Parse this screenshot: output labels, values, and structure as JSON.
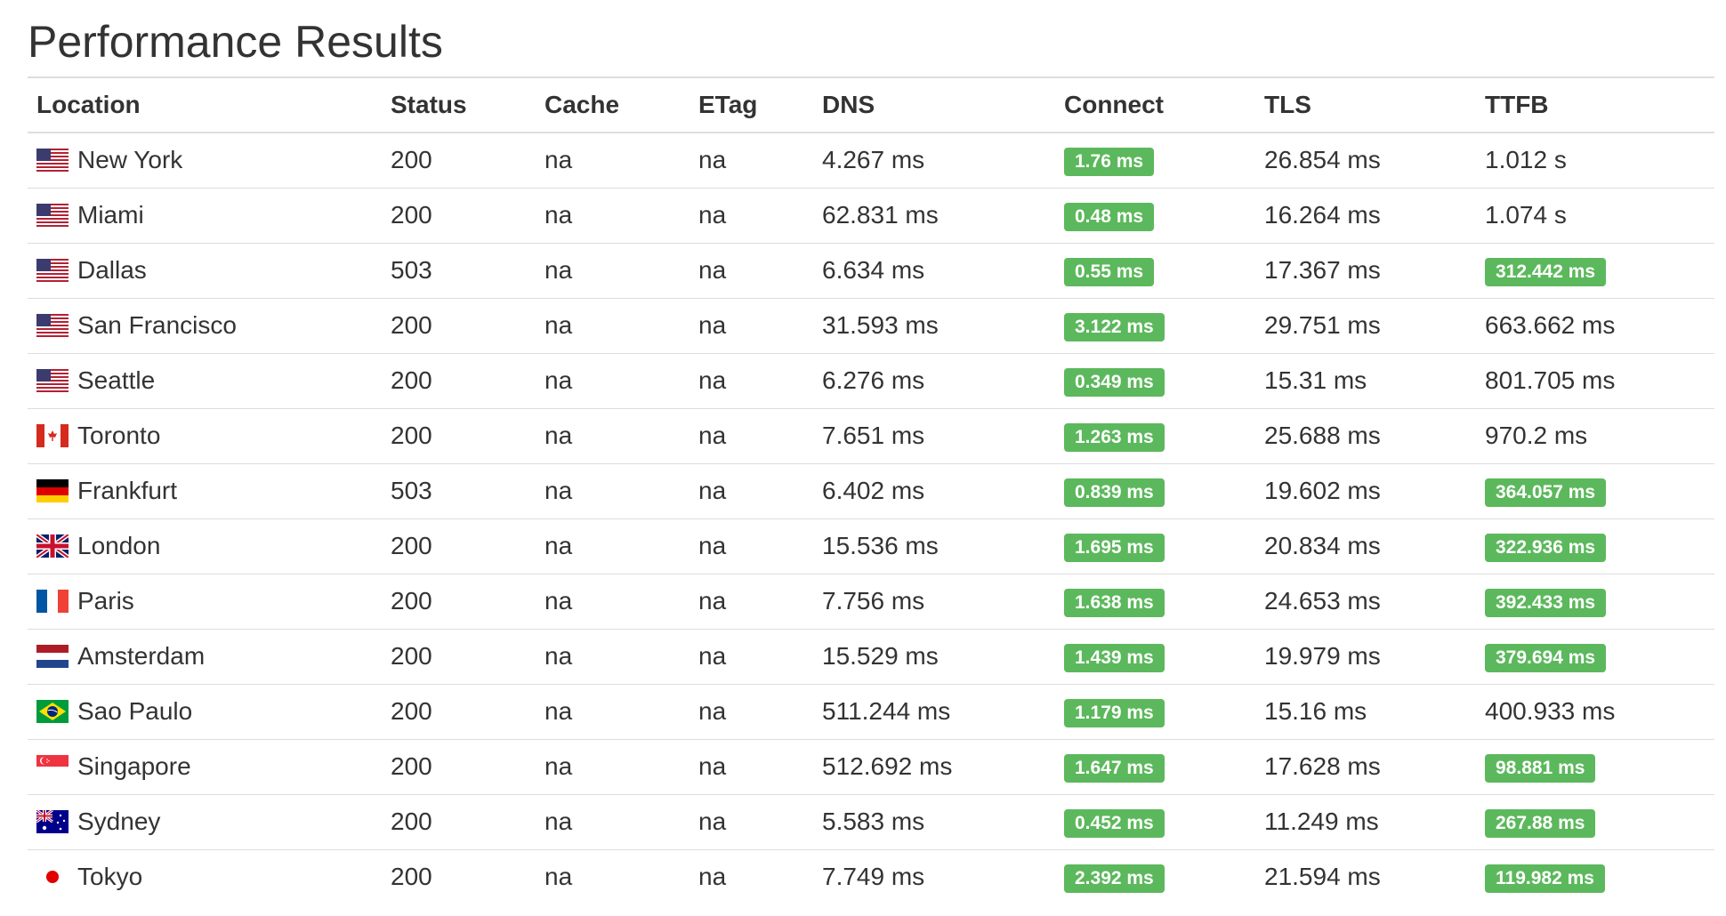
{
  "page": {
    "title": "Performance Results"
  },
  "columns": [
    "Location",
    "Status",
    "Cache",
    "ETag",
    "DNS",
    "Connect",
    "TLS",
    "TTFB"
  ],
  "rows": [
    {
      "flag": "us-flag-icon",
      "location": "New York",
      "status": "200",
      "cache": "na",
      "etag": "na",
      "dns": "4.267 ms",
      "connect": "1.76 ms",
      "connect_highlight": true,
      "tls": "26.854 ms",
      "ttfb": "1.012 s",
      "ttfb_highlight": false
    },
    {
      "flag": "us-flag-icon",
      "location": "Miami",
      "status": "200",
      "cache": "na",
      "etag": "na",
      "dns": "62.831 ms",
      "connect": "0.48 ms",
      "connect_highlight": true,
      "tls": "16.264 ms",
      "ttfb": "1.074 s",
      "ttfb_highlight": false
    },
    {
      "flag": "us-flag-icon",
      "location": "Dallas",
      "status": "503",
      "cache": "na",
      "etag": "na",
      "dns": "6.634 ms",
      "connect": "0.55 ms",
      "connect_highlight": true,
      "tls": "17.367 ms",
      "ttfb": "312.442 ms",
      "ttfb_highlight": true
    },
    {
      "flag": "us-flag-icon",
      "location": "San Francisco",
      "status": "200",
      "cache": "na",
      "etag": "na",
      "dns": "31.593 ms",
      "connect": "3.122 ms",
      "connect_highlight": true,
      "tls": "29.751 ms",
      "ttfb": "663.662 ms",
      "ttfb_highlight": false
    },
    {
      "flag": "us-flag-icon",
      "location": "Seattle",
      "status": "200",
      "cache": "na",
      "etag": "na",
      "dns": "6.276 ms",
      "connect": "0.349 ms",
      "connect_highlight": true,
      "tls": "15.31 ms",
      "ttfb": "801.705 ms",
      "ttfb_highlight": false
    },
    {
      "flag": "ca-flag-icon",
      "location": "Toronto",
      "status": "200",
      "cache": "na",
      "etag": "na",
      "dns": "7.651 ms",
      "connect": "1.263 ms",
      "connect_highlight": true,
      "tls": "25.688 ms",
      "ttfb": "970.2 ms",
      "ttfb_highlight": false
    },
    {
      "flag": "de-flag-icon",
      "location": "Frankfurt",
      "status": "503",
      "cache": "na",
      "etag": "na",
      "dns": "6.402 ms",
      "connect": "0.839 ms",
      "connect_highlight": true,
      "tls": "19.602 ms",
      "ttfb": "364.057 ms",
      "ttfb_highlight": true
    },
    {
      "flag": "gb-flag-icon",
      "location": "London",
      "status": "200",
      "cache": "na",
      "etag": "na",
      "dns": "15.536 ms",
      "connect": "1.695 ms",
      "connect_highlight": true,
      "tls": "20.834 ms",
      "ttfb": "322.936 ms",
      "ttfb_highlight": true
    },
    {
      "flag": "fr-flag-icon",
      "location": "Paris",
      "status": "200",
      "cache": "na",
      "etag": "na",
      "dns": "7.756 ms",
      "connect": "1.638 ms",
      "connect_highlight": true,
      "tls": "24.653 ms",
      "ttfb": "392.433 ms",
      "ttfb_highlight": true
    },
    {
      "flag": "nl-flag-icon",
      "location": "Amsterdam",
      "status": "200",
      "cache": "na",
      "etag": "na",
      "dns": "15.529 ms",
      "connect": "1.439 ms",
      "connect_highlight": true,
      "tls": "19.979 ms",
      "ttfb": "379.694 ms",
      "ttfb_highlight": true
    },
    {
      "flag": "br-flag-icon",
      "location": "Sao Paulo",
      "status": "200",
      "cache": "na",
      "etag": "na",
      "dns": "511.244 ms",
      "connect": "1.179 ms",
      "connect_highlight": true,
      "tls": "15.16 ms",
      "ttfb": "400.933 ms",
      "ttfb_highlight": false
    },
    {
      "flag": "sg-flag-icon",
      "location": "Singapore",
      "status": "200",
      "cache": "na",
      "etag": "na",
      "dns": "512.692 ms",
      "connect": "1.647 ms",
      "connect_highlight": true,
      "tls": "17.628 ms",
      "ttfb": "98.881 ms",
      "ttfb_highlight": true
    },
    {
      "flag": "au-flag-icon",
      "location": "Sydney",
      "status": "200",
      "cache": "na",
      "etag": "na",
      "dns": "5.583 ms",
      "connect": "0.452 ms",
      "connect_highlight": true,
      "tls": "11.249 ms",
      "ttfb": "267.88 ms",
      "ttfb_highlight": true
    },
    {
      "flag": "jp-flag-icon",
      "location": "Tokyo",
      "status": "200",
      "cache": "na",
      "etag": "na",
      "dns": "7.749 ms",
      "connect": "2.392 ms",
      "connect_highlight": true,
      "tls": "21.594 ms",
      "ttfb": "119.982 ms",
      "ttfb_highlight": true
    }
  ]
}
